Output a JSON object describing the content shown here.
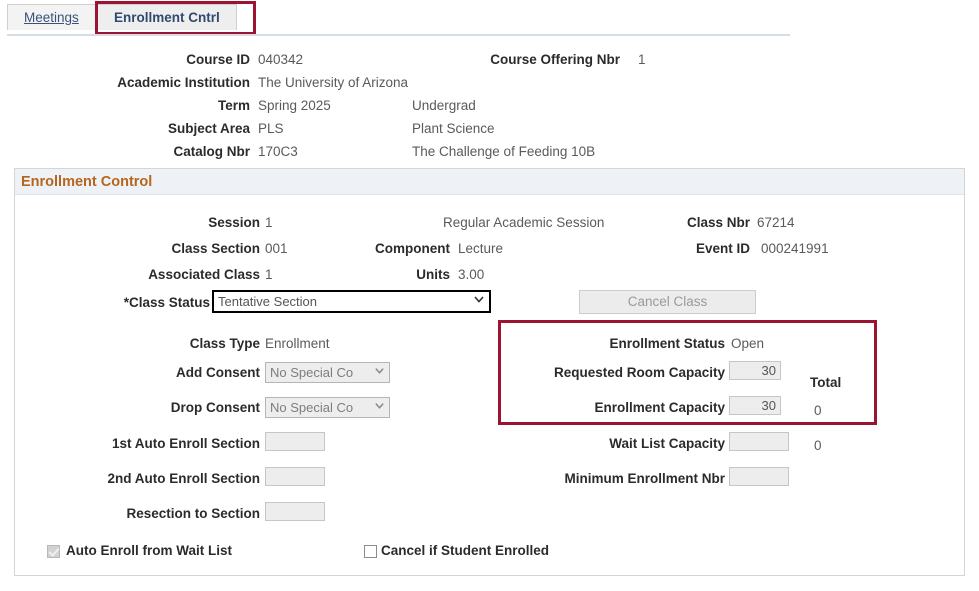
{
  "tabs": [
    {
      "id": "meetings",
      "label": "Meetings",
      "active": false
    },
    {
      "id": "enrollment_cntrl",
      "label": "Enrollment Cntrl",
      "active": true
    }
  ],
  "header": {
    "rows": [
      {
        "label": "Course ID",
        "value": "040342",
        "desc": ""
      },
      {
        "label": "Academic Institution",
        "value": "The University of Arizona",
        "desc": ""
      },
      {
        "label": "Term",
        "value": "Spring 2025",
        "desc": "Undergrad"
      },
      {
        "label": "Subject Area",
        "value": "PLS",
        "desc": "Plant Science"
      },
      {
        "label": "Catalog Nbr",
        "value": "170C3",
        "desc": "The Challenge of Feeding 10B"
      }
    ],
    "course_offering_nbr_label": "Course Offering Nbr",
    "course_offering_nbr_value": "1"
  },
  "group": {
    "title": "Enrollment Control",
    "session_label": "Session",
    "session_value": "1",
    "session_desc": "Regular Academic Session",
    "class_section_label": "Class Section",
    "class_section_value": "001",
    "component_label": "Component",
    "component_value": "Lecture",
    "associated_class_label": "Associated Class",
    "associated_class_value": "1",
    "units_label": "Units",
    "units_value": "3.00",
    "class_nbr_label": "Class Nbr",
    "class_nbr_value": "67214",
    "event_id_label": "Event ID",
    "event_id_value": "000241991",
    "class_status_label": "*Class Status",
    "class_status_value": "Tentative Section",
    "cancel_class_label": "Cancel Class",
    "class_type_label": "Class Type",
    "class_type_value": "Enrollment",
    "add_consent_label": "Add Consent",
    "add_consent_value": "No Special Co",
    "drop_consent_label": "Drop Consent",
    "drop_consent_value": "No Special Co",
    "first_auto_enroll_label": "1st Auto Enroll Section",
    "first_auto_enroll_value": "",
    "second_auto_enroll_label": "2nd Auto Enroll Section",
    "second_auto_enroll_value": "",
    "resection_label": "Resection to Section",
    "resection_value": "",
    "enrollment_status_label": "Enrollment Status",
    "enrollment_status_value": "Open",
    "requested_room_capacity_label": "Requested Room Capacity",
    "requested_room_capacity_value": "30",
    "enrollment_capacity_label": "Enrollment Capacity",
    "enrollment_capacity_value": "30",
    "total_label": "Total",
    "total_enrollment_value": "0",
    "total_waitlist_value": "0",
    "wait_list_capacity_label": "Wait List Capacity",
    "wait_list_capacity_value": "",
    "minimum_enrollment_label": "Minimum Enrollment Nbr",
    "minimum_enrollment_value": "",
    "auto_enroll_waitlist_label": "Auto Enroll from Wait List",
    "cancel_if_student_enrolled_label": "Cancel if Student Enrolled"
  },
  "colors": {
    "highlight": "#9c1432",
    "group_title": "#b5651d",
    "group_bar_bg": "#eef2f6",
    "tab_text": "#3a5378"
  },
  "icons": {
    "dropdown_carat": "⌄"
  }
}
